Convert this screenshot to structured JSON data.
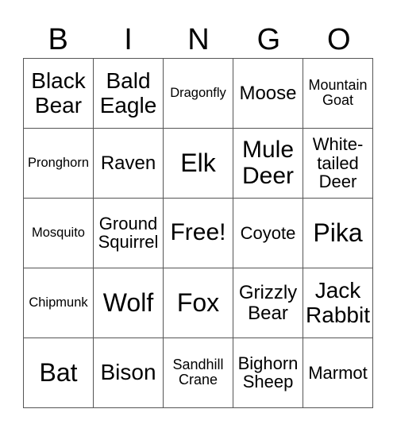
{
  "header": {
    "letters": [
      "B",
      "I",
      "N",
      "G",
      "O"
    ]
  },
  "card": {
    "rows": [
      [
        "Black Bear",
        "Bald Eagle",
        "Dragonfly",
        "Moose",
        "Mountain Goat"
      ],
      [
        "Pronghorn",
        "Raven",
        "Elk",
        "Mule Deer",
        "White-tailed Deer"
      ],
      [
        "Mosquito",
        "Ground Squirrel",
        "Free!",
        "Coyote",
        "Pika"
      ],
      [
        "Chipmunk",
        "Wolf",
        "Fox",
        "Grizzly Bear",
        "Jack Rabbit"
      ],
      [
        "Bat",
        "Bison",
        "Sandhill Crane",
        "Bighorn Sheep",
        "Marmot"
      ]
    ],
    "free_space": "Free!"
  }
}
